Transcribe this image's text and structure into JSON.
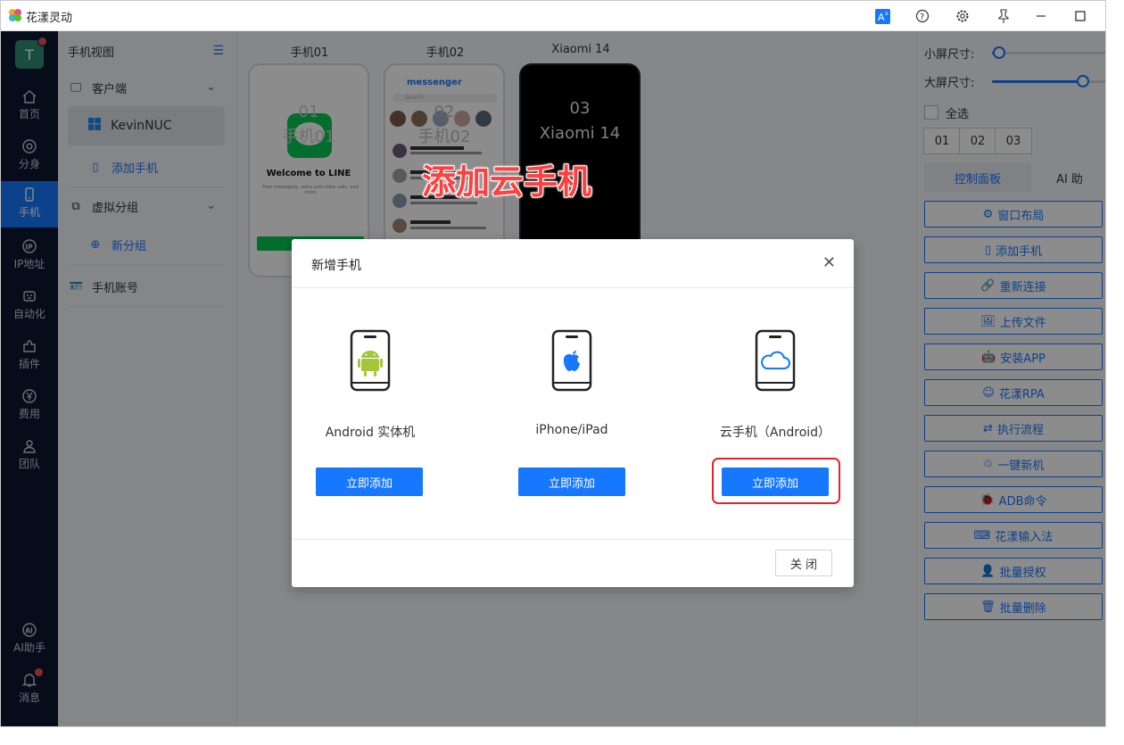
{
  "window": {
    "title": "花漾灵动",
    "controls": [
      "translate-icon",
      "help-icon",
      "gear-icon",
      "pin-icon",
      "minimize-icon",
      "maximize-icon"
    ]
  },
  "user": {
    "avatar_letter": "T"
  },
  "nav": [
    {
      "label": "首页",
      "icon": "home-icon"
    },
    {
      "label": "分身",
      "icon": "chrome-icon"
    },
    {
      "label": "手机",
      "icon": "phone-icon",
      "active": true
    },
    {
      "label": "IP地址",
      "icon": "ip-icon"
    },
    {
      "label": "自动化",
      "icon": "robot-icon"
    },
    {
      "label": "插件",
      "icon": "puzzle-icon"
    },
    {
      "label": "费用",
      "icon": "yen-icon"
    },
    {
      "label": "团队",
      "icon": "team-icon"
    },
    {
      "label": "AI助手",
      "icon": "ai-icon"
    },
    {
      "label": "消息",
      "icon": "bell-icon"
    }
  ],
  "sidebar": {
    "title": "手机视图",
    "client_label": "客户端",
    "client_item": "KevinNUC",
    "add_phone": "添加手机",
    "group_label": "虚拟分组",
    "new_group": "新分组",
    "account_label": "手机账号"
  },
  "phones": [
    {
      "label": "手机01",
      "num": "01",
      "name": "手机01",
      "screen_text": "Welcome to LINE",
      "screen_sub": "Free messaging, voice and video calls, and more"
    },
    {
      "label": "手机02",
      "num": "02",
      "name": "手机02",
      "screen_text": "messenger",
      "search": "Search"
    },
    {
      "label": "Xiaomi 14",
      "num": "03",
      "name": "Xiaomi 14"
    }
  ],
  "right_panel": {
    "small_size_label": "小屏尺寸:",
    "large_size_label": "大屏尺寸:",
    "small_size_level": 0.05,
    "large_size_level": 0.78,
    "select_all": "全选",
    "numbers": [
      "01",
      "02",
      "03"
    ],
    "tab_control": "控制面板",
    "tab_ai": "AI 助",
    "buttons": [
      {
        "label": "窗口布局",
        "icon": "layout-gear-icon"
      },
      {
        "label": "添加手机",
        "icon": "phone-icon"
      },
      {
        "label": "重新连接",
        "icon": "link-icon"
      },
      {
        "label": "上传文件",
        "icon": "image-upload-icon"
      },
      {
        "label": "安装APP",
        "icon": "android-icon"
      },
      {
        "label": "花漾RPA",
        "icon": "robot-icon"
      },
      {
        "label": "执行流程",
        "icon": "flow-icon"
      },
      {
        "label": "一键新机",
        "icon": "recycle-icon"
      },
      {
        "label": "ADB命令",
        "icon": "bug-icon"
      },
      {
        "label": "花漾输入法",
        "icon": "keyboard-icon"
      },
      {
        "label": "批量授权",
        "icon": "user-auth-icon"
      },
      {
        "label": "批量删除",
        "icon": "trash-icon"
      }
    ]
  },
  "modal": {
    "title": "新增手机",
    "options": [
      {
        "label": "Android 实体机",
        "button": "立即添加",
        "icon": "android-icon"
      },
      {
        "label": "iPhone/iPad",
        "button": "立即添加",
        "icon": "apple-icon"
      },
      {
        "label": "云手机（Android）",
        "button": "立即添加",
        "icon": "cloud-icon"
      }
    ],
    "close_button": "关 闭"
  },
  "annotation": "添加云手机",
  "colors": {
    "accent": "#1677ff",
    "nav_bg": "#0e1730",
    "highlight": "#e1242b"
  }
}
